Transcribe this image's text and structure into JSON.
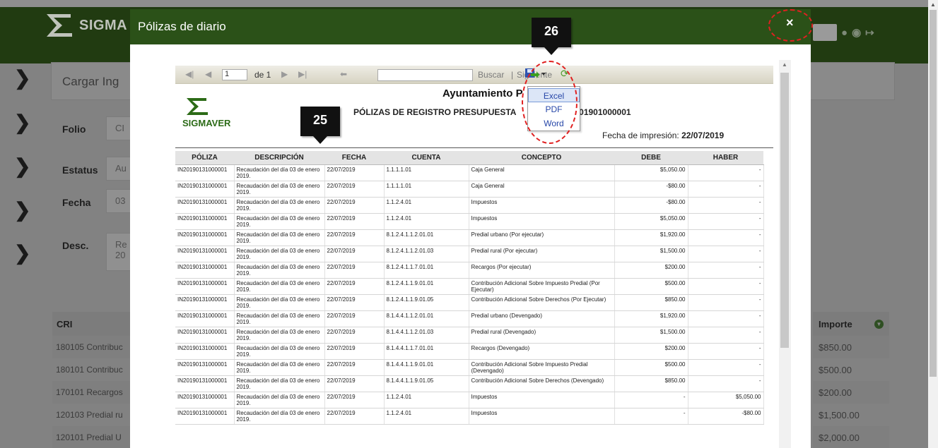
{
  "app": {
    "logo_text": "SIGMA",
    "card_title": "Cargar Ing",
    "fields": [
      {
        "label": "Folio",
        "value": "CI"
      },
      {
        "label": "Estatus",
        "value": "Au"
      },
      {
        "label": "Fecha",
        "value": "03"
      },
      {
        "label": "Desc.",
        "value": "Re 20"
      }
    ],
    "cri_header": "CRI",
    "cri_rows": [
      "180105 Contribuc",
      "180101 Contribuc",
      "170101 Recargos",
      "120103 Predial ru",
      "120101 Predial U"
    ],
    "importe_header": "Importe",
    "importe_rows": [
      "$850.00",
      "$500.00",
      "$200.00",
      "$1,500.00",
      "$2,000.00"
    ]
  },
  "modal": {
    "title": "Pólizas de diario",
    "close_glyph": "×"
  },
  "toolbar": {
    "page_value": "1",
    "of_label": "de 1",
    "search_label": "Buscar",
    "separator": "|",
    "next_label": "Siguiente"
  },
  "export_menu": {
    "items": [
      "Excel",
      "PDF",
      "Word"
    ]
  },
  "report": {
    "logo_text": "SIGMAVER",
    "title": "Ayuntamiento P",
    "subtitle_left": "PÓLIZAS DE REGISTRO PRESUPUESTA",
    "subtitle_right": "201901000001",
    "print_date_label": "Fecha de impresión:",
    "print_date": "22/07/2019",
    "columns": [
      "PÓLIZA",
      "DESCRIPCIÓN",
      "FECHA",
      "CUENTA",
      "CONCEPTO",
      "DEBE",
      "HABER"
    ],
    "rows": [
      [
        "IN20190131000001",
        "Recaudación del día 03 de enero 2019.",
        "22/07/2019",
        "1.1.1.1.01",
        "Caja General",
        "$5,050.00",
        "-"
      ],
      [
        "IN20190131000001",
        "Recaudación del día 03 de enero 2019.",
        "22/07/2019",
        "1.1.1.1.01",
        "Caja General",
        "-$80.00",
        "-"
      ],
      [
        "IN20190131000001",
        "Recaudación del día 03 de enero 2019.",
        "22/07/2019",
        "1.1.2.4.01",
        "Impuestos",
        "-$80.00",
        "-"
      ],
      [
        "IN20190131000001",
        "Recaudación del día 03 de enero 2019.",
        "22/07/2019",
        "1.1.2.4.01",
        "Impuestos",
        "$5,050.00",
        "-"
      ],
      [
        "IN20190131000001",
        "Recaudación del día 03 de enero 2019.",
        "22/07/2019",
        "8.1.2.4.1.1.2.01.01",
        "Predial urbano (Por ejecutar)",
        "$1,920.00",
        "-"
      ],
      [
        "IN20190131000001",
        "Recaudación del día 03 de enero 2019.",
        "22/07/2019",
        "8.1.2.4.1.1.2.01.03",
        "Predial rural (Por ejecutar)",
        "$1,500.00",
        "-"
      ],
      [
        "IN20190131000001",
        "Recaudación del día 03 de enero 2019.",
        "22/07/2019",
        "8.1.2.4.1.1.7.01.01",
        "Recargos (Por ejecutar)",
        "$200.00",
        "-"
      ],
      [
        "IN20190131000001",
        "Recaudación del día 03 de enero 2019.",
        "22/07/2019",
        "8.1.2.4.1.1.9.01.01",
        "Contribución Adicional Sobre Impuesto Predial (Por Ejecutar)",
        "$500.00",
        "-"
      ],
      [
        "IN20190131000001",
        "Recaudación del día 03 de enero 2019.",
        "22/07/2019",
        "8.1.2.4.1.1.9.01.05",
        "Contribución Adicional Sobre Derechos (Por Ejecutar)",
        "$850.00",
        "-"
      ],
      [
        "IN20190131000001",
        "Recaudación del día 03 de enero 2019.",
        "22/07/2019",
        "8.1.4.4.1.1.2.01.01",
        "Predial urbano (Devengado)",
        "$1,920.00",
        "-"
      ],
      [
        "IN20190131000001",
        "Recaudación del día 03 de enero 2019.",
        "22/07/2019",
        "8.1.4.4.1.1.2.01.03",
        "Predial rural (Devengado)",
        "$1,500.00",
        "-"
      ],
      [
        "IN20190131000001",
        "Recaudación del día 03 de enero 2019.",
        "22/07/2019",
        "8.1.4.4.1.1.7.01.01",
        "Recargos (Devengado)",
        "$200.00",
        "-"
      ],
      [
        "IN20190131000001",
        "Recaudación del día 03 de enero 2019.",
        "22/07/2019",
        "8.1.4.4.1.1.9.01.01",
        "Contribución Adicional Sobre Impuesto Predial (Devengado)",
        "$500.00",
        "-"
      ],
      [
        "IN20190131000001",
        "Recaudación del día 03 de enero 2019.",
        "22/07/2019",
        "8.1.4.4.1.1.9.01.05",
        "Contribución Adicional Sobre Derechos (Devengado)",
        "$850.00",
        "-"
      ],
      [
        "IN20190131000001",
        "Recaudación del día 03 de enero 2019.",
        "22/07/2019",
        "1.1.2.4.01",
        "Impuestos",
        "-",
        "$5,050.00"
      ],
      [
        "IN20190131000001",
        "Recaudación del día 03 de enero 2019.",
        "22/07/2019",
        "1.1.2.4.01",
        "Impuestos",
        "-",
        "-$80.00"
      ]
    ]
  },
  "callouts": [
    "26",
    "25"
  ],
  "colors": {
    "header_green": "#2b5118",
    "annotation_red": "#e02020",
    "link_blue": "#2747a8"
  }
}
